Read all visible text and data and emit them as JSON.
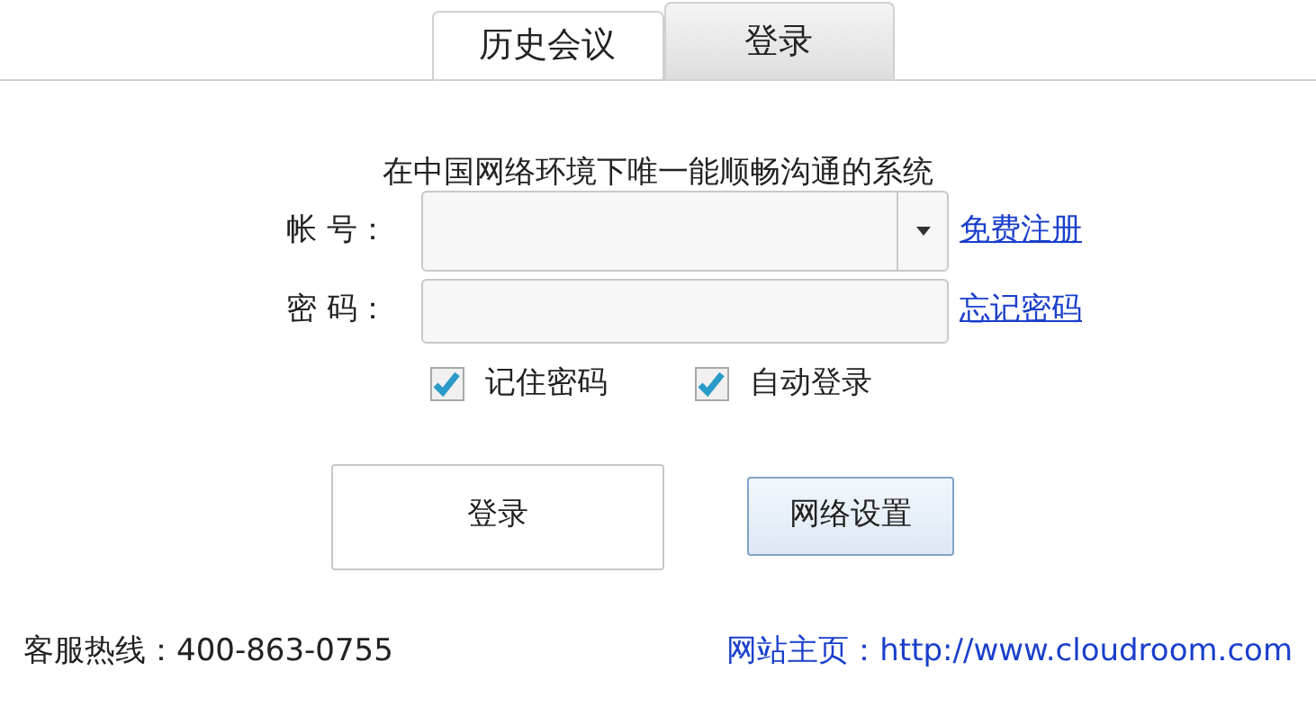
{
  "tabs": [
    {
      "label": "历史会议",
      "selected": false
    },
    {
      "label": "登录",
      "selected": true
    }
  ],
  "login_form": {
    "slogan": "在中国网络环境下唯一能顺畅沟通的系统",
    "account": {
      "label": "帐 号：",
      "link": "免费注册"
    },
    "password": {
      "label": "密 码：",
      "link": "忘记密码"
    },
    "checkboxes": [
      {
        "label": "记住密码",
        "checked": true
      },
      {
        "label": "自动登录",
        "checked": true
      }
    ],
    "buttons": [
      {
        "label": "登录",
        "kind": "plain"
      },
      {
        "label": "网络设置",
        "kind": "highlight"
      }
    ]
  },
  "footer": {
    "hotline": "客服热线：400-863-0755",
    "website": "网站主页：http://www.cloudroom.com"
  }
}
